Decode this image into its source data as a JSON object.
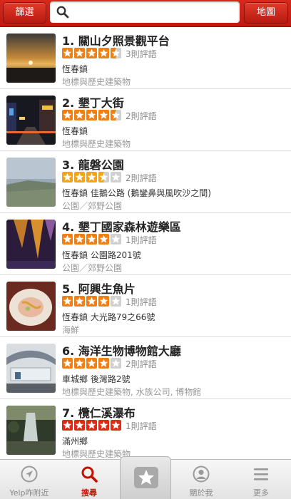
{
  "header": {
    "filter_label": "篩選",
    "map_label": "地圖",
    "search_value": "",
    "search_placeholder": ""
  },
  "colors": {
    "brand_red": "#c41200",
    "star_red": "#e02a16",
    "star_orange": "#f07f14",
    "star_empty": "#d0d0d0"
  },
  "results": [
    {
      "title": "1. 關山夕照景觀平台",
      "rating": 4.5,
      "star_color": "#f07f14",
      "reviews": "3則評語",
      "address": "恆春鎮",
      "category": "地標與歷史建築物",
      "thumb_icon": "sunset-photo"
    },
    {
      "title": "2. 墾丁大街",
      "rating": 4.5,
      "star_color": "#f07f14",
      "reviews": "2則評語",
      "address": "恆春鎮",
      "category": "地標與歷史建築物",
      "thumb_icon": "night-street-photo"
    },
    {
      "title": "3. 龍磐公園",
      "rating": 3.5,
      "star_color": "#f2a51c",
      "reviews": "2則評語",
      "address": "恆春鎮 佳鵝公路 (鵝鑾鼻與風吹沙之間)",
      "category": "公園／郊野公園",
      "thumb_icon": "grassland-photo"
    },
    {
      "title": "4. 墾丁國家森林遊樂區",
      "rating": 4,
      "star_color": "#f07f14",
      "reviews": "1則評語",
      "address": "恆春鎮 公園路201號",
      "category": "公園／郊野公園",
      "thumb_icon": "cave-photo"
    },
    {
      "title": "5. 阿興生魚片",
      "rating": 4,
      "star_color": "#f07f14",
      "reviews": "1則評語",
      "address": "恆春鎮 大光路79之66號",
      "category": "海鮮",
      "thumb_icon": "sashimi-photo"
    },
    {
      "title": "6. 海洋生物博物館大廳",
      "rating": 4,
      "star_color": "#f07f14",
      "reviews": "2則評語",
      "address": "車城鄉 後灣路2號",
      "category": "地標與歷史建築物, 水族公司, 博物館",
      "thumb_icon": "aquarium-photo"
    },
    {
      "title": "7. 欖仁溪瀑布",
      "rating": 5,
      "star_color": "#e02a16",
      "reviews": "1則評語",
      "address": "滿州鄉",
      "category": "地標與歷史建築物",
      "thumb_icon": "waterfall-photo"
    }
  ],
  "tabs": [
    {
      "label": "Yelp咋附近",
      "icon": "compass-icon"
    },
    {
      "label": "搜尋",
      "icon": "search-icon",
      "active": true
    },
    {
      "label": "",
      "icon": "star-badge-icon"
    },
    {
      "label": "關於我",
      "icon": "person-icon"
    },
    {
      "label": "更多",
      "icon": "menu-icon"
    }
  ]
}
